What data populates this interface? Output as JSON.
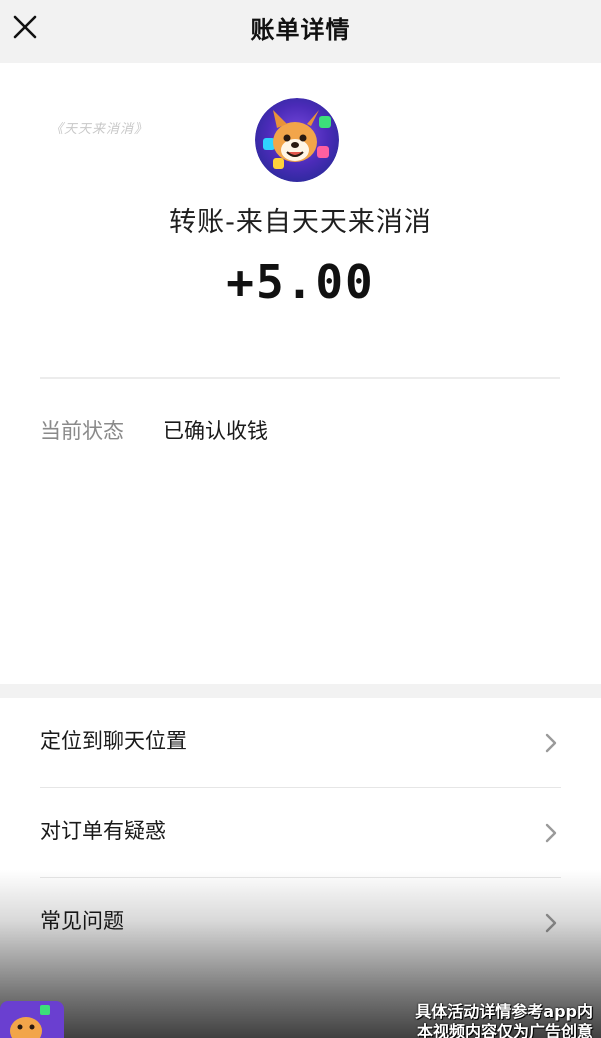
{
  "navbar": {
    "title": "账单详情",
    "close_icon": "close-icon"
  },
  "header": {
    "watermark": "《天天来消消》",
    "avatar_icon": "game-mascot-avatar",
    "transfer_title": "转账-来自天天来消消",
    "amount": "+5.00"
  },
  "status": {
    "label": "当前状态",
    "value": "已确认收钱"
  },
  "menu": {
    "items": [
      {
        "label": "定位到聊天位置",
        "icon": "chevron-right-icon"
      },
      {
        "label": "对订单有疑惑",
        "icon": "chevron-right-icon"
      },
      {
        "label": "常见问题",
        "icon": "chevron-right-icon"
      }
    ]
  },
  "footer": {
    "disclaimer_line1": "具体活动详情参考app内",
    "disclaimer_line2": "本视频内容仅为广告创意"
  },
  "colors": {
    "navbar_bg": "#f2f2f2",
    "label_gray": "#8a8a8a",
    "text_dark": "#1a1a1a"
  }
}
